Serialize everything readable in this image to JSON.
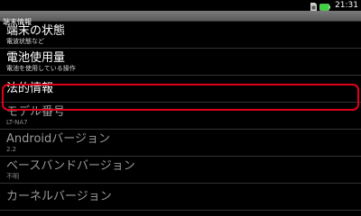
{
  "status_bar": {
    "time": "21:31",
    "icons": [
      "sim-icon",
      "battery-icon"
    ],
    "battery_color": "#3fd13f"
  },
  "header": {
    "title": "端末情報"
  },
  "items": [
    {
      "title": "端末の状態",
      "summary": "電波状態など",
      "enabled": true
    },
    {
      "title": "電池使用量",
      "summary": "電池を使用している操作",
      "enabled": true
    },
    {
      "title": "法的情報",
      "summary": "",
      "enabled": true
    },
    {
      "title": "モデル番号",
      "summary": "LT-NA7",
      "enabled": false
    },
    {
      "title": "Androidバージョン",
      "summary": "2.2",
      "enabled": false
    },
    {
      "title": "ベースバンドバージョン",
      "summary": "不明",
      "enabled": false
    },
    {
      "title": "カーネルバージョン",
      "summary": "",
      "enabled": false
    }
  ],
  "highlight_color": "#e0001a"
}
